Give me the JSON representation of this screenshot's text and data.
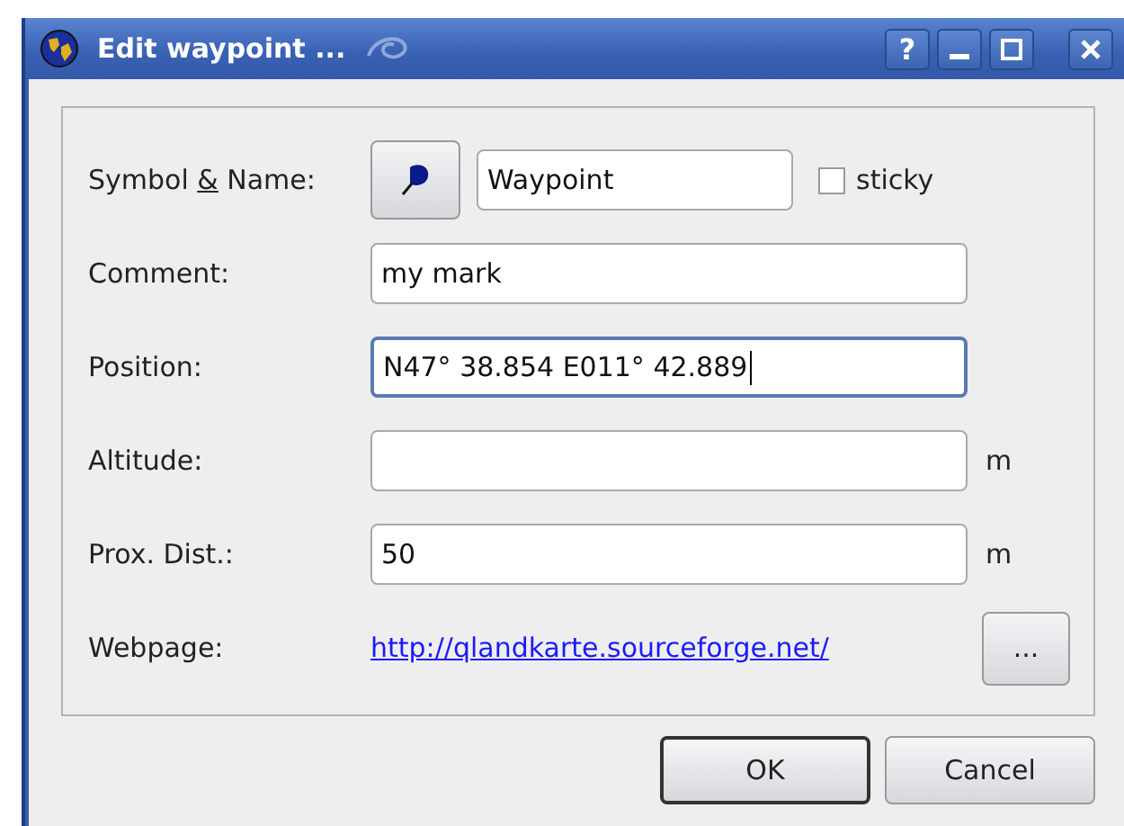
{
  "window": {
    "title": "Edit waypoint ...",
    "help_button": "?"
  },
  "symbol_row": {
    "label_parts": [
      {
        "text": "Symbol ",
        "underline": false
      },
      {
        "text": "&",
        "underline": true
      },
      {
        "text": " Name:",
        "underline": false
      }
    ],
    "name_value": "Waypoint",
    "sticky": {
      "label": "sticky",
      "checked": false
    }
  },
  "fields": [
    {
      "label": "Comment:",
      "value": "my mark",
      "focused": false
    },
    {
      "label": "Position:",
      "value": "N47° 38.854 E011° 42.889",
      "focused": true
    },
    {
      "label": "Altitude:",
      "unit": "m",
      "focused": false
    },
    {
      "label": "Prox. Dist.:",
      "value": "50",
      "unit": "m",
      "focused": false
    }
  ],
  "webpage": {
    "label": "Webpage:",
    "link": "http://qlandkarte.sourceforge.net/",
    "browse_button": "..."
  },
  "buttons": [
    {
      "label": "OK",
      "default": true
    },
    {
      "label": "Cancel",
      "default": false
    }
  ]
}
